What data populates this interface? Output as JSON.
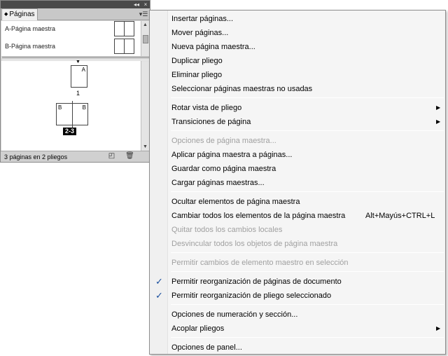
{
  "panel": {
    "tab_label": "Páginas",
    "tab_arrows": "◆",
    "collapse_glyph": "◂◂",
    "close_glyph": "×",
    "menu_glyph": "▾☰",
    "masters": [
      {
        "label": "A-Página maestra"
      },
      {
        "label": "B-Página maestra"
      }
    ],
    "page1_letter": "A",
    "page1_number": "1",
    "spread_left_letter": "B",
    "spread_right_letter": "B",
    "spread_number": "2-3",
    "status_text": "3 páginas en 2 pliegos",
    "new_page_icon": "◰",
    "delete_icon": "🗑"
  },
  "menu": {
    "groups": [
      [
        {
          "label": "Insertar páginas...",
          "disabled": false
        },
        {
          "label": "Mover páginas...",
          "disabled": false
        },
        {
          "label": "Nueva página maestra...",
          "disabled": false
        },
        {
          "label": "Duplicar pliego",
          "disabled": false
        },
        {
          "label": "Eliminar pliego",
          "disabled": false
        },
        {
          "label": "Seleccionar páginas maestras no usadas",
          "disabled": false
        }
      ],
      [
        {
          "label": "Rotar vista de pliego",
          "submenu": true
        },
        {
          "label": "Transiciones de página",
          "submenu": true
        }
      ],
      [
        {
          "label": "Opciones de página maestra...",
          "disabled": true
        },
        {
          "label": "Aplicar página maestra a páginas...",
          "disabled": false
        },
        {
          "label": "Guardar como página maestra",
          "disabled": false
        },
        {
          "label": "Cargar páginas maestras...",
          "disabled": false
        }
      ],
      [
        {
          "label": "Ocultar elementos de página maestra",
          "disabled": false
        },
        {
          "label": "Cambiar todos los elementos de la página maestra",
          "shortcut": "Alt+Mayús+CTRL+L"
        },
        {
          "label": "Quitar todos los cambios locales",
          "disabled": true
        },
        {
          "label": "Desvincular todos los objetos de página maestra",
          "disabled": true
        }
      ],
      [
        {
          "label": "Permitir cambios de elemento maestro en selección",
          "disabled": true
        }
      ],
      [
        {
          "label": "Permitir reorganización de páginas de documento",
          "checked": true
        },
        {
          "label": "Permitir reorganización de pliego seleccionado",
          "checked": true
        }
      ],
      [
        {
          "label": "Opciones de numeración y sección...",
          "disabled": false
        },
        {
          "label": "Acoplar pliegos",
          "submenu": true
        }
      ],
      [
        {
          "label": "Opciones de panel...",
          "disabled": false
        }
      ]
    ],
    "check_glyph": "✓",
    "submenu_glyph": "▶"
  }
}
